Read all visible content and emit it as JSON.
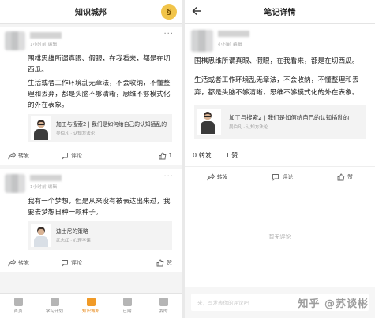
{
  "left": {
    "title": "知识城邦",
    "avatar_char": "§",
    "posts": [
      {
        "meta": "1小时前 编辑",
        "paragraphs": [
          "围棋思维所谓真眼、假眼，在我看来，都是在切西瓜。",
          "生活或者工作环境乱无章法，不会收纳，不懂整理和丢弃，都是头脑不够清晰，思维不够模式化的外在表象。"
        ],
        "ref_title": "加工与搜索2 | 我们是如何给自己的认知插乱的",
        "ref_sub": "吴伯凡 · 认知方法论",
        "forward": "转发",
        "comment": "评论",
        "like": "1"
      },
      {
        "meta": "1小时前 编辑",
        "paragraphs": [
          "我有一个梦想，但是从来没有被表达出来过，我要去梦想日种一颗种子。"
        ],
        "ref_title": "迪士尼的策略",
        "ref_sub": "武志红 · 心理学课",
        "forward": "转发",
        "comment": "评论",
        "like": "赞"
      }
    ],
    "tabs": [
      {
        "label": "首页",
        "icon": "home-icon"
      },
      {
        "label": "学习计划",
        "icon": "plan-icon"
      },
      {
        "label": "知识城邦",
        "icon": "city-icon"
      },
      {
        "label": "已购",
        "icon": "purchased-icon"
      },
      {
        "label": "我的",
        "icon": "profile-icon"
      }
    ],
    "active_tab": 2
  },
  "right": {
    "title": "笔记详情",
    "meta": "小时前 编辑",
    "paragraphs": [
      "围棋思维所谓真眼、假眼，在我看来，都是在切西瓜。",
      "生活或者工作环境乱无章法，不会收纳，不懂整理和丢弃，都是头脑不够清晰，思维不够模式化的外在表象。"
    ],
    "ref_title": "加工与搜索2 | 我们是如何给自己的认知插乱的",
    "ref_sub": "吴伯凡 · 认知方法论",
    "stats_forward": "0 转发",
    "stats_like": "1 赞",
    "forward": "转发",
    "comment": "评论",
    "like": "赞",
    "no_comment": "暂无评论",
    "comment_placeholder": "来，写发表你的评论吧",
    "watermark": "知乎 @苏谈彬"
  },
  "colors": {
    "accent": "#f09a27",
    "background": "#f4f4f4"
  }
}
